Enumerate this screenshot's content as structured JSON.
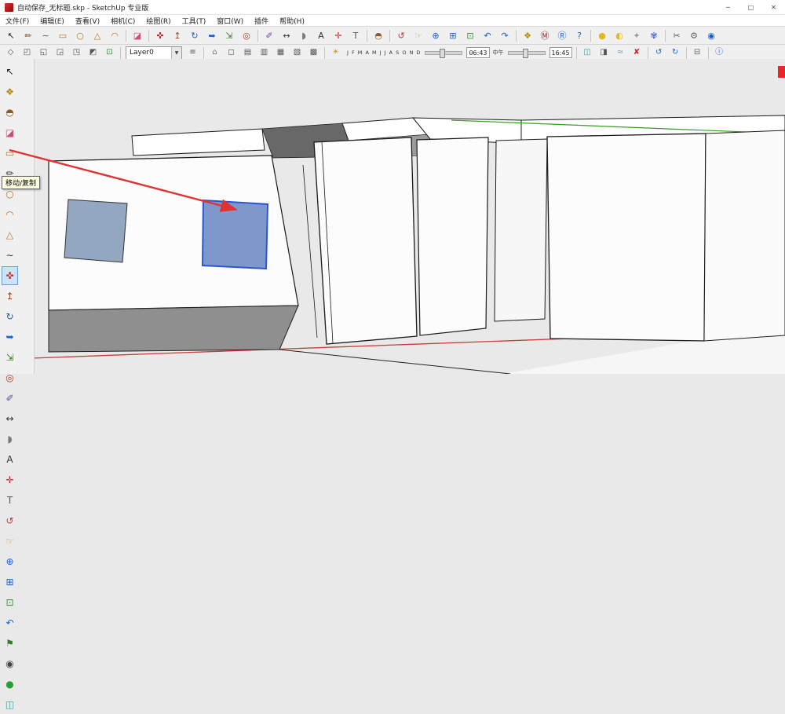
{
  "window": {
    "title": "自动保存_无标题.skp - SketchUp 专业版",
    "minimize": "─",
    "maximize": "□",
    "close": "✕"
  },
  "menu": {
    "items": [
      {
        "name": "file",
        "label": "文件(F)"
      },
      {
        "name": "edit",
        "label": "编辑(E)"
      },
      {
        "name": "view",
        "label": "查看(V)"
      },
      {
        "name": "camera",
        "label": "相机(C)"
      },
      {
        "name": "draw",
        "label": "绘图(R)"
      },
      {
        "name": "tools",
        "label": "工具(T)"
      },
      {
        "name": "window",
        "label": "窗口(W)"
      },
      {
        "name": "plugins",
        "label": "插件"
      },
      {
        "name": "help",
        "label": "帮助(H)"
      }
    ]
  },
  "toolbar1": {
    "icons": [
      {
        "name": "select-tool",
        "glyph": "↖",
        "color": "#222222"
      },
      {
        "name": "line-tool",
        "glyph": "✏",
        "color": "#7a4a21"
      },
      {
        "name": "freehand-tool",
        "glyph": "∼",
        "color": "#555555"
      },
      {
        "name": "rectangle-tool",
        "glyph": "▭",
        "color": "#b5722a"
      },
      {
        "name": "circle-tool",
        "glyph": "○",
        "color": "#b5722a"
      },
      {
        "name": "polygon-tool",
        "glyph": "△",
        "color": "#b5722a"
      },
      {
        "name": "arc-tool",
        "glyph": "◠",
        "color": "#b5722a"
      },
      {
        "sep": true
      },
      {
        "name": "eraser-tool",
        "glyph": "◪",
        "color": "#c94f7c"
      },
      {
        "sep": true
      },
      {
        "name": "move-tool",
        "glyph": "✜",
        "color": "#cc2222"
      },
      {
        "name": "push-pull-tool",
        "glyph": "↥",
        "color": "#a04020"
      },
      {
        "name": "rotate-tool",
        "glyph": "↻",
        "color": "#1a5fd0"
      },
      {
        "name": "follow-me-tool",
        "glyph": "➥",
        "color": "#1a5fd0"
      },
      {
        "name": "scale-tool",
        "glyph": "⇲",
        "color": "#3a7a2a"
      },
      {
        "name": "offset-tool",
        "glyph": "◎",
        "color": "#a04020"
      },
      {
        "sep": true
      },
      {
        "name": "tape-measure-tool",
        "glyph": "✐",
        "color": "#6a4a9a"
      },
      {
        "name": "dimension-tool",
        "glyph": "↔",
        "color": "#333333"
      },
      {
        "name": "protractor-tool",
        "glyph": "◗",
        "color": "#7a7a7a"
      },
      {
        "name": "text-tool",
        "glyph": "A",
        "color": "#333333"
      },
      {
        "name": "axes-tool",
        "glyph": "✛",
        "color": "#cc2222"
      },
      {
        "name": "3d-text-tool",
        "glyph": "T",
        "color": "#555555"
      },
      {
        "sep": true
      },
      {
        "name": "paint-bucket-tool",
        "glyph": "◓",
        "color": "#8b5a2b"
      },
      {
        "sep": true
      },
      {
        "name": "orbit-tool",
        "glyph": "↺",
        "color": "#cc3333"
      },
      {
        "name": "pan-tool",
        "glyph": "☞",
        "color": "#c8a05a"
      },
      {
        "name": "zoom-tool",
        "glyph": "⊕",
        "color": "#1a5fd0"
      },
      {
        "name": "zoom-window-tool",
        "glyph": "⊞",
        "color": "#1a5fd0"
      },
      {
        "name": "zoom-extents-tool",
        "glyph": "⊡",
        "color": "#3a8a3a"
      },
      {
        "name": "previous-view-tool",
        "glyph": "↶",
        "color": "#1a5fd0"
      },
      {
        "name": "next-view-tool",
        "glyph": "↷",
        "color": "#1a5fd0"
      },
      {
        "sep": true
      },
      {
        "name": "make-component-tool",
        "glyph": "❖",
        "color": "#b8860b"
      },
      {
        "name": "warehouse-icon",
        "glyph": "Ⓜ",
        "color": "#8b1a2a"
      },
      {
        "name": "share-model-icon",
        "glyph": "Ⓡ",
        "color": "#1a5fd0"
      },
      {
        "name": "help-icon",
        "glyph": "?",
        "color": "#1a5fd0"
      },
      {
        "sep": true
      },
      {
        "name": "sun-icon",
        "glyph": "●",
        "color": "#e3b71e"
      },
      {
        "name": "shadow-ball-icon",
        "glyph": "◐",
        "color": "#e3b71e"
      },
      {
        "name": "star-icon",
        "glyph": "✦",
        "color": "#999999"
      },
      {
        "name": "flower-icon",
        "glyph": "✾",
        "color": "#4a6ad0"
      },
      {
        "sep": true
      },
      {
        "name": "scissors-icon",
        "glyph": "✂",
        "color": "#555555"
      },
      {
        "name": "gear-icon",
        "glyph": "⚙",
        "color": "#666666"
      },
      {
        "name": "globe-icon",
        "glyph": "◉",
        "color": "#1a5fd0"
      }
    ]
  },
  "toolbar2": {
    "view_icons": [
      {
        "name": "view-iso-icon",
        "glyph": "◇",
        "color": "#555555"
      },
      {
        "name": "view-top-icon",
        "glyph": "◰",
        "color": "#555555"
      },
      {
        "name": "view-front-icon",
        "glyph": "◱",
        "color": "#555555"
      },
      {
        "name": "view-right-icon",
        "glyph": "◲",
        "color": "#555555"
      },
      {
        "name": "view-back-icon",
        "glyph": "◳",
        "color": "#555555"
      },
      {
        "name": "view-left-icon",
        "glyph": "◩",
        "color": "#555555"
      },
      {
        "name": "zoom-extents-icon",
        "glyph": "⊡",
        "color": "#3a8a3a"
      },
      {
        "sep": true
      }
    ],
    "layer_value": "Layer0",
    "dropdown_arrow": "▼",
    "layer_icons": [
      {
        "name": "layer-manager-icon",
        "glyph": "≡",
        "color": "#555555"
      },
      {
        "sep": true
      }
    ],
    "style_icons": [
      {
        "name": "display-xray-icon",
        "glyph": "⌂",
        "color": "#777777"
      },
      {
        "name": "display-wireframe-icon",
        "glyph": "◻",
        "color": "#555555"
      },
      {
        "name": "display-hiddenline-icon",
        "glyph": "▤",
        "color": "#555555"
      },
      {
        "name": "display-shaded-icon",
        "glyph": "▥",
        "color": "#555555"
      },
      {
        "name": "display-textured-icon",
        "glyph": "▦",
        "color": "#555555"
      },
      {
        "name": "display-mono-icon",
        "glyph": "▧",
        "color": "#555555"
      },
      {
        "name": "display-backedge-icon",
        "glyph": "▩",
        "color": "#555555"
      },
      {
        "sep": true
      },
      {
        "name": "shadow-settings-icon",
        "glyph": "☀",
        "color": "#c79a2a"
      }
    ],
    "shadow": {
      "months": "J F M A M J J A S O N D",
      "time_start": "06:43",
      "noon_label": "中午",
      "time_end": "16:45"
    },
    "right_icons": [
      {
        "sep": true
      },
      {
        "name": "section-plane-icon",
        "glyph": "◫",
        "color": "#3aa0a0"
      },
      {
        "name": "section-cuts-icon",
        "glyph": "◨",
        "color": "#555555"
      },
      {
        "name": "fog-icon",
        "glyph": "≈",
        "color": "#8899aa"
      },
      {
        "name": "delete-icon",
        "glyph": "✘",
        "color": "#cc2222"
      },
      {
        "sep": true
      },
      {
        "name": "undo-icon",
        "glyph": "↺",
        "color": "#1a5fd0"
      },
      {
        "name": "redo-icon",
        "glyph": "↻",
        "color": "#1a5fd0"
      },
      {
        "sep": true
      },
      {
        "name": "print-icon",
        "glyph": "⊟",
        "color": "#666666"
      },
      {
        "sep": true
      },
      {
        "name": "model-info-icon",
        "glyph": "ⓘ",
        "color": "#1a5fd0"
      }
    ]
  },
  "left_toolbar": {
    "icons": [
      {
        "name": "lt-select-tool",
        "glyph": "↖",
        "color": "#111111"
      },
      {
        "name": "lt-make-component-tool",
        "glyph": "❖",
        "color": "#b8860b"
      },
      {
        "name": "lt-paint-bucket-tool",
        "glyph": "◓",
        "color": "#8b5a2b"
      },
      {
        "name": "lt-eraser-tool",
        "glyph": "◪",
        "color": "#c94f7c"
      },
      {
        "name": "lt-rectangle-tool",
        "glyph": "▭",
        "color": "#b5722a"
      },
      {
        "name": "lt-line-tool",
        "glyph": "✏",
        "color": "#333333"
      },
      {
        "name": "lt-circle-tool",
        "glyph": "○",
        "color": "#b5722a"
      },
      {
        "name": "lt-arc-tool",
        "glyph": "◠",
        "color": "#b5722a"
      },
      {
        "name": "lt-polygon-tool",
        "glyph": "△",
        "color": "#b5722a"
      },
      {
        "name": "lt-freehand-tool",
        "glyph": "∼",
        "color": "#333333"
      },
      {
        "name": "lt-move-tool",
        "glyph": "✜",
        "color": "#cc2222",
        "active": true
      },
      {
        "name": "lt-push-pull-tool",
        "glyph": "↥",
        "color": "#a04020"
      },
      {
        "name": "lt-rotate-tool",
        "glyph": "↻",
        "color": "#1a5fd0"
      },
      {
        "name": "lt-follow-me-tool",
        "glyph": "➥",
        "color": "#1a5fd0"
      },
      {
        "name": "lt-scale-tool",
        "glyph": "⇲",
        "color": "#3a7a2a"
      },
      {
        "name": "lt-offset-tool",
        "glyph": "◎",
        "color": "#a04020"
      },
      {
        "name": "lt-tape-measure-tool",
        "glyph": "✐",
        "color": "#6a4a9a"
      },
      {
        "name": "lt-dimension-tool",
        "glyph": "↔",
        "color": "#333333"
      },
      {
        "name": "lt-protractor-tool",
        "glyph": "◗",
        "color": "#7a7a7a"
      },
      {
        "name": "lt-text-tool",
        "glyph": "A",
        "color": "#333333"
      },
      {
        "name": "lt-axes-tool",
        "glyph": "✛",
        "color": "#cc2222"
      },
      {
        "name": "lt-3d-text-tool",
        "glyph": "T",
        "color": "#555555"
      },
      {
        "name": "lt-orbit-tool",
        "glyph": "↺",
        "color": "#cc3333"
      },
      {
        "name": "lt-pan-tool",
        "glyph": "☞",
        "color": "#c8a05a"
      },
      {
        "name": "lt-zoom-tool",
        "glyph": "⊕",
        "color": "#1a5fd0"
      },
      {
        "name": "lt-zoom-window-tool",
        "glyph": "⊞",
        "color": "#1a5fd0"
      },
      {
        "name": "lt-zoom-extents-tool",
        "glyph": "⊡",
        "color": "#3a8a3a"
      },
      {
        "name": "lt-previous-view-tool",
        "glyph": "↶",
        "color": "#1a5fd0"
      },
      {
        "name": "lt-position-camera-tool",
        "glyph": "⚑",
        "color": "#3a7a2a"
      },
      {
        "name": "lt-look-around-tool",
        "glyph": "◉",
        "color": "#444444"
      },
      {
        "name": "lt-walk-tool",
        "glyph": "●",
        "color": "#2a9d3a"
      },
      {
        "name": "lt-section-plane-tool",
        "glyph": "◫",
        "color": "#3aa0a0"
      }
    ]
  },
  "tooltip": {
    "text": "移动/复制"
  },
  "annotation": {
    "arrow_color": "#e03434"
  },
  "viewport": {
    "colors": {
      "background": "#e9e9e9",
      "face_white": "#fcfcfc",
      "roof_dark": "#686868",
      "roof_gray": "#9b9b9b",
      "window_fill": "#93a7c0",
      "selected_window_fill": "#8097cc",
      "selection_stroke": "#2a56d4",
      "axis_red": "#c83c3c",
      "axis_green": "#3a9d23",
      "edge": "#1a1a1a",
      "ground_gray": "#8f8f8f"
    }
  }
}
